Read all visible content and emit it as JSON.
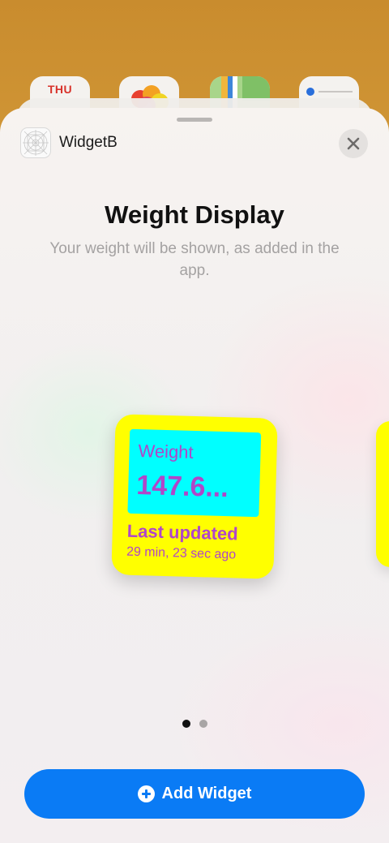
{
  "home": {
    "calendar_day": "THU"
  },
  "sheet": {
    "app_name": "WidgetB",
    "title": "Weight Display",
    "subtitle": "Your weight will be shown, as added in the app."
  },
  "widget": {
    "label": "Weight",
    "value": "147.6...",
    "updated_label": "Last updated",
    "updated_time": "29 min, 23 sec ago",
    "colors": {
      "background": "#ffff00",
      "panel": "#00ffff",
      "text": "#b046c9"
    }
  },
  "pagination": {
    "current_page": 1,
    "total_pages": 2
  },
  "add_button": {
    "label": "Add Widget",
    "color": "#0a7bf5"
  }
}
